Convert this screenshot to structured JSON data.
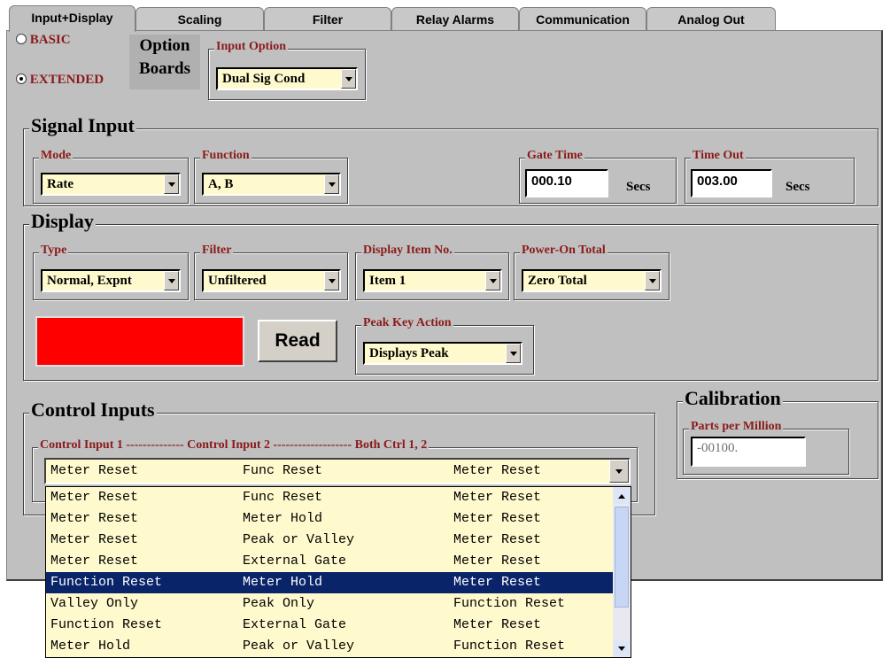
{
  "tabs": [
    "Input+Display",
    "Scaling",
    "Filter",
    "Relay Alarms",
    "Communication",
    "Analog Out"
  ],
  "mode_radio": {
    "basic": "BASIC",
    "extended": "EXTENDED",
    "selected": "EXTENDED"
  },
  "option_boards": {
    "line1": "Option",
    "line2": "Boards"
  },
  "input_option": {
    "label": "Input Option",
    "value": "Dual Sig Cond"
  },
  "signal_input": {
    "title": "Signal Input",
    "mode": {
      "label": "Mode",
      "value": "Rate"
    },
    "function": {
      "label": "Function",
      "value": "A, B"
    },
    "gate_time": {
      "label": "Gate Time",
      "value": "000.10",
      "unit": "Secs"
    },
    "time_out": {
      "label": "Time Out",
      "value": "003.00",
      "unit": "Secs"
    }
  },
  "display": {
    "title": "Display",
    "type": {
      "label": "Type",
      "value": "Normal, Expnt"
    },
    "filter": {
      "label": "Filter",
      "value": "Unfiltered"
    },
    "display_item": {
      "label": "Display Item No.",
      "value": "Item 1"
    },
    "power_on_total": {
      "label": "Power-On Total",
      "value": "Zero Total"
    },
    "read_button": "Read",
    "indicator_color": "#ff0000",
    "peak_key_action": {
      "label": "Peak Key Action",
      "value": "Displays Peak"
    }
  },
  "control_inputs": {
    "title": "Control Inputs",
    "legend": "Control Input 1 -------------- Control Input 2 ------------------- Both Ctrl 1, 2",
    "selected": [
      "Meter Reset",
      "Func Reset",
      "Meter Reset"
    ],
    "options": [
      [
        "Meter Reset",
        "Func Reset",
        "Meter Reset"
      ],
      [
        "Meter Reset",
        "Meter Hold",
        "Meter Reset"
      ],
      [
        "Meter Reset",
        "Peak or Valley",
        "Meter Reset"
      ],
      [
        "Meter Reset",
        "External Gate",
        "Meter Reset"
      ],
      [
        "Function Reset",
        "Meter Hold",
        "Meter Reset"
      ],
      [
        "Valley Only",
        "Peak Only",
        "Function Reset"
      ],
      [
        "Function Reset",
        "External Gate",
        "Meter Reset"
      ],
      [
        "Meter Hold",
        "Peak or Valley",
        "Function Reset"
      ]
    ],
    "highlighted_index": 4
  },
  "calibration": {
    "title": "Calibration",
    "label": "Parts per Million",
    "value": "-00100."
  },
  "colors": {
    "panel": "#c0c0c0",
    "label_red": "#8b1a1a",
    "combo_bg": "#fffacd",
    "highlight": "#0a246a"
  }
}
